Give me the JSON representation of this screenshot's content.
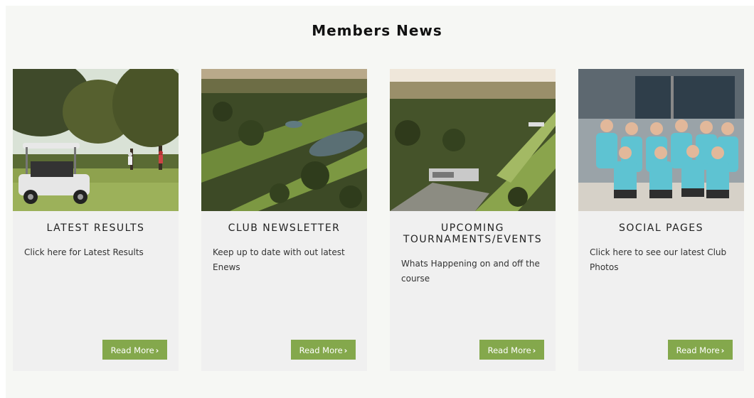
{
  "section": {
    "title": "Members News"
  },
  "colors": {
    "background": "#f6f7f4",
    "card": "#f0f0f0",
    "button": "#84a84c",
    "button_text": "#ffffff"
  },
  "cards": [
    {
      "title": "LATEST RESULTS",
      "text": "Click here for Latest Results",
      "button": "Read More",
      "button_icon": "chevron-right-icon"
    },
    {
      "title": "CLUB NEWSLETTER",
      "text": "Keep up to date with out latest Enews",
      "button": "Read More",
      "button_icon": "chevron-right-icon"
    },
    {
      "title": "UPCOMING TOURNAMENTS/EVENTS",
      "text": "Whats Happening on and off the course",
      "button": "Read More",
      "button_icon": "chevron-right-icon"
    },
    {
      "title": "SOCIAL PAGES",
      "text": "Click here to see our latest Club Photos",
      "button": "Read More",
      "button_icon": "chevron-right-icon"
    }
  ]
}
